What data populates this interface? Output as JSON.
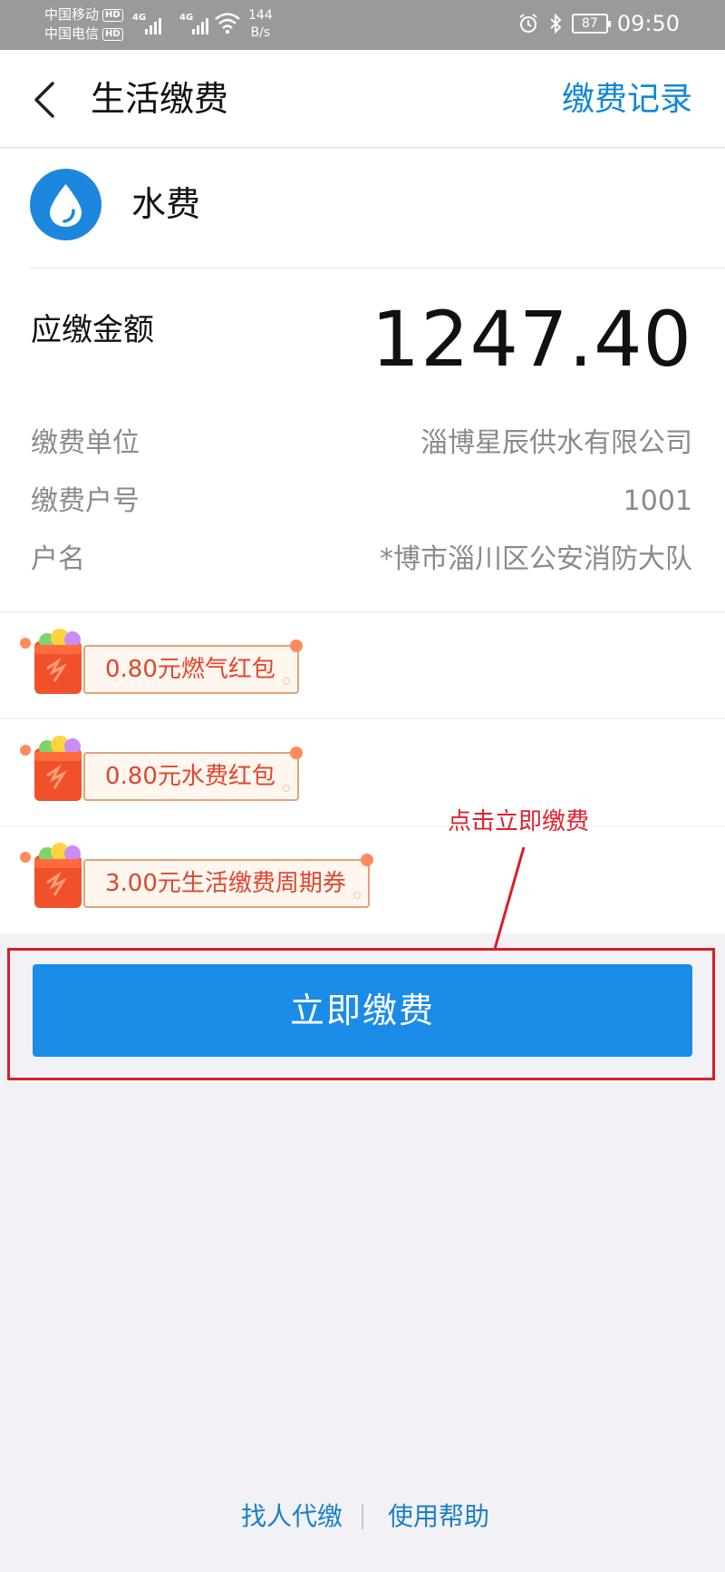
{
  "status_bar": {
    "carrier_1": "中国移动",
    "carrier_2": "中国电信",
    "hd_badge": "HD",
    "network_tag": "4G",
    "speed_value": "144",
    "speed_unit": "B/s",
    "battery": "87",
    "time": "09:50"
  },
  "header": {
    "title": "生活缴费",
    "record_link": "缴费记录"
  },
  "bill": {
    "name": "水费",
    "icon": "water-drop-icon"
  },
  "amount": {
    "label": "应缴金额",
    "value": "1247.40"
  },
  "info": [
    {
      "label": "缴费单位",
      "value": "淄博星辰供水有限公司"
    },
    {
      "label": "缴费户号",
      "value": "1001"
    },
    {
      "label": "户名",
      "value": "*博市淄川区公安消防大队"
    }
  ],
  "coupons": [
    {
      "text": "0.80元燃气红包"
    },
    {
      "text": "0.80元水费红包"
    },
    {
      "text": "3.00元生活缴费周期券"
    }
  ],
  "pay_button": "立即缴费",
  "annotation": "点击立即缴费",
  "footer": {
    "link_1": "找人代缴",
    "link_2": "使用帮助"
  },
  "colors": {
    "accent": "#1a8ce8",
    "link": "#1486d6",
    "annotation": "#d81e2a",
    "coupon_text": "#e0462e"
  }
}
